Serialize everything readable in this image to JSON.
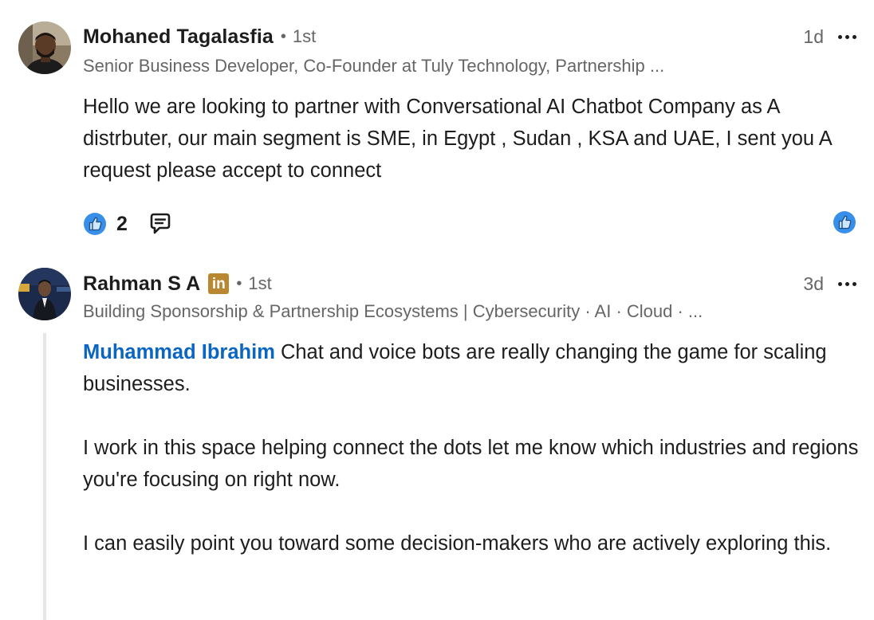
{
  "comments": [
    {
      "author": "Mohaned Tagalasfia",
      "degree_separator": "•",
      "degree": "1st",
      "time": "1d",
      "headline": "Senior Business Developer, Co-Founder at Tuly Technology, Partnership ...",
      "body": "Hello we are looking to partner with Conversational AI Chatbot Company as A distrbuter, our main segment is SME, in Egypt , Sudan , KSA and UAE, I sent you A request please accept to connect",
      "like_count": "2"
    },
    {
      "author": "Rahman S A",
      "badge": "in",
      "degree_separator": "•",
      "degree": "1st",
      "time": "3d",
      "headline": "Building Sponsorship & Partnership Ecosystems | Cybersecurity · AI · Cloud · ...",
      "mention": "Muhammad Ibrahim",
      "paragraphs": [
        " Chat and voice bots are really changing the game for scaling businesses.",
        "I work in this space helping connect the dots let me know which industries and regions you're focusing on right now.",
        "I can easily point you toward some decision-makers who are actively exploring this."
      ]
    }
  ],
  "icons": {
    "like": "thumbs-up-icon",
    "reply": "speech-bubble-icon",
    "more": "more-options-icon",
    "badge": "linkedin-badge-icon"
  },
  "colors": {
    "mention": "#0a66c2",
    "like_blue": "#378fe9",
    "badge_gold": "#b8872f",
    "secondary_text": "#666666"
  }
}
